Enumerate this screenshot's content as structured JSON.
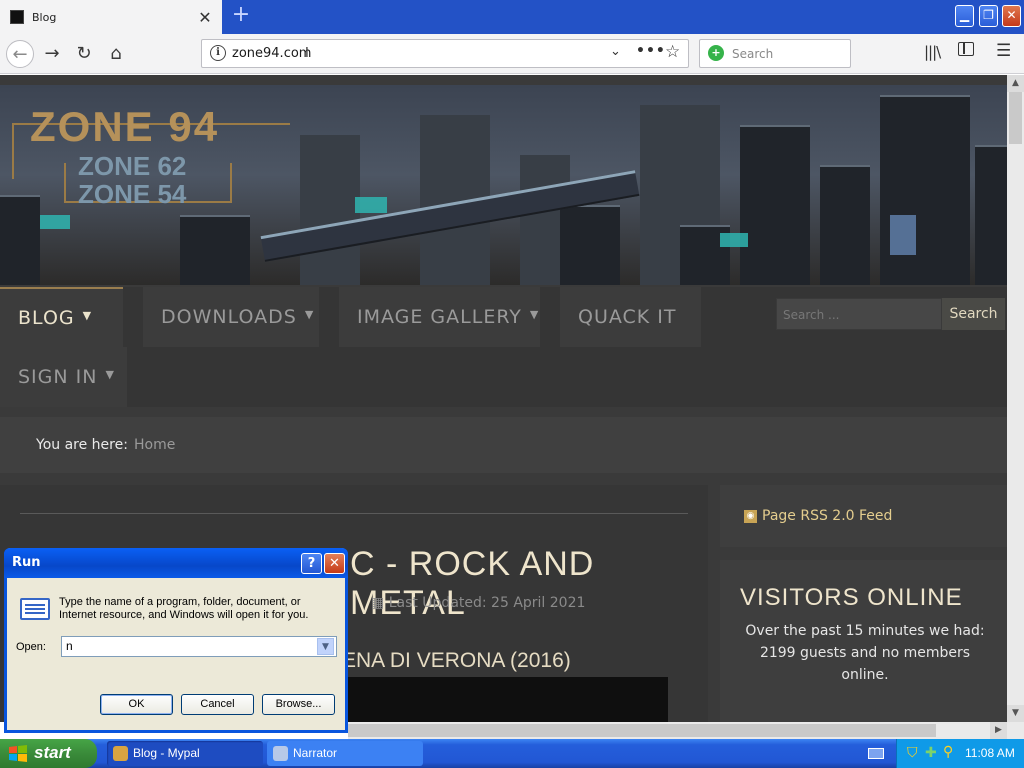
{
  "browser": {
    "tab_title": "Blog",
    "tab_close": "✕",
    "new_tab": "+",
    "url": "zone94.com",
    "search_placeholder": "Search",
    "window_buttons": {
      "minimize": "▁",
      "restore": "❐",
      "close": "✕"
    }
  },
  "site": {
    "logo_main": "ZONE 94",
    "logo_sub1": "ZONE 62",
    "logo_sub2": "ZONE 54",
    "menu": [
      {
        "label": "BLOG",
        "dropdown": true
      },
      {
        "label": "DOWNLOADS",
        "dropdown": true
      },
      {
        "label": "IMAGE GALLERY",
        "dropdown": true
      },
      {
        "label": "QUACK IT",
        "dropdown": false
      },
      {
        "label": "SIGN IN",
        "dropdown": true
      }
    ],
    "search_placeholder": "Search ...",
    "search_button": "Search",
    "breadcrumb_label": "You are here:",
    "breadcrumb_home": "Home",
    "article_title": "C - ROCK AND METAL",
    "article_date": "Last Updated: 25 April 2021",
    "article_subtitle": "ENA DI VERONA (2016)",
    "rss_label": "Page RSS 2.0 Feed",
    "visitors_title": "VISITORS ONLINE",
    "visitors_text": "Over the past 15 minutes we had: 2199 guests and no members online."
  },
  "run_dialog": {
    "title": "Run",
    "help": "?",
    "close": "✕",
    "description": "Type the name of a program, folder, document, or Internet resource, and Windows will open it for you.",
    "open_label": "Open:",
    "input_value": "n",
    "ok": "OK",
    "cancel": "Cancel",
    "browse": "Browse..."
  },
  "taskbar": {
    "start": "start",
    "buttons": [
      {
        "label": "Blog - Mypal"
      },
      {
        "label": "Narrator"
      }
    ],
    "clock": "11:08 AM"
  },
  "colors": {
    "accent_gold": "#e4cd8e",
    "page_bg": "#3a3a3a",
    "xp_blue": "#245edb"
  }
}
